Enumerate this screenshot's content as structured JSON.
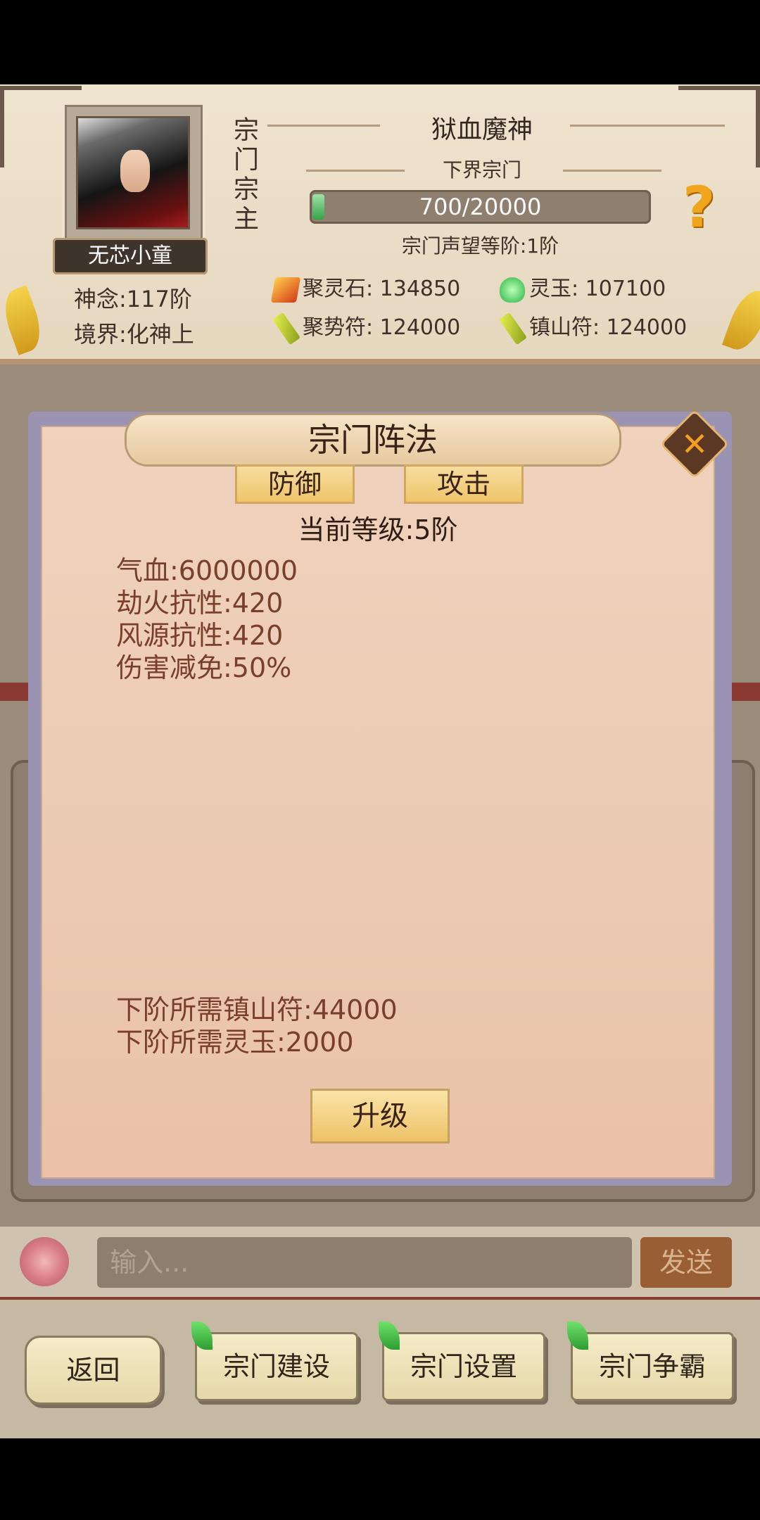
{
  "header": {
    "player_name": "无芯小童",
    "role_vertical": [
      "宗",
      "门",
      "宗",
      "主"
    ],
    "sect_name": "狱血魔神",
    "sect_type": "下界宗门",
    "reputation": {
      "current": 700,
      "max": 20000,
      "text": "700/20000"
    },
    "reputation_rank": "宗门声望等阶:1阶",
    "shennian": "神念:117阶",
    "realm": "境界:化神上",
    "help_icon": "?"
  },
  "resources": {
    "juling_stone": "聚灵石: 134850",
    "lingyu": "灵玉: 107100",
    "jushi_fu": "聚势符: 124000",
    "zhenshan_fu": "镇山符: 124000"
  },
  "dialog": {
    "title": "宗门阵法",
    "close": "✕",
    "tabs": [
      "防御",
      "攻击"
    ],
    "current_level": "当前等级:5阶",
    "stats": [
      "气血:6000000",
      "劫火抗性:420",
      "风源抗性:420",
      "伤害减免:50%"
    ],
    "requirements": [
      "下阶所需镇山符:44000",
      "下阶所需灵玉:2000"
    ],
    "upgrade": "升级"
  },
  "chat": {
    "placeholder": "输入...",
    "send": "发送"
  },
  "nav": {
    "back": "返回",
    "build": "宗门建设",
    "settings": "宗门设置",
    "contest": "宗门争霸"
  }
}
